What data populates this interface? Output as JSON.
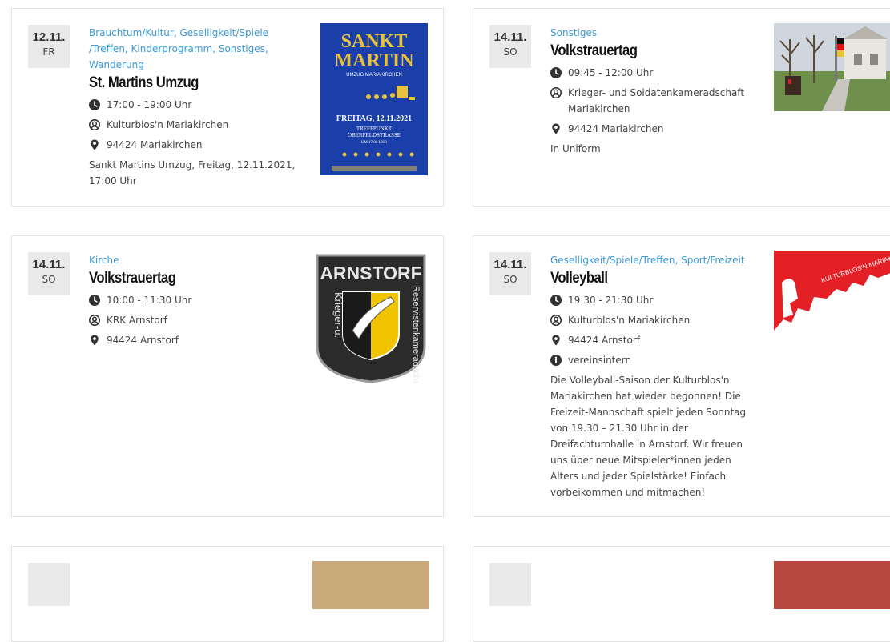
{
  "events": [
    {
      "day": "12.11.",
      "weekday": "FR",
      "categories": "Brauchtum/Kultur, Geselligkeit/Spiele /Treffen, Kinderprogramm, Sonstiges, Wanderung",
      "title": "St. Martins Umzug",
      "time": "17:00 - 19:00 Uhr",
      "organizer": "Kulturblos'n Mariakirchen",
      "location": "94424 Mariakirchen",
      "description": "Sankt Martins Umzug, Freitag, 12.11.2021, 17:00 Uhr",
      "poster": {
        "line1": "SANKT",
        "line2": "MARTIN",
        "line3": "UMZUG MARIAKIRCHEN",
        "line4": "FREITAG, 12.11.2021",
        "line5": "TREFFPUNKT",
        "line6": "OBERFELDSTRASSE",
        "line7": "UM 17:00 UHR"
      }
    },
    {
      "day": "14.11.",
      "weekday": "SO",
      "categories": "Sonstiges",
      "title": "Volkstrauertag",
      "time": "09:45 - 12:00 Uhr",
      "organizer": "Krieger- und Soldatenkameradschaft Mariakirchen",
      "location": "94424 Mariakirchen",
      "description": "In Uniform"
    },
    {
      "day": "14.11.",
      "weekday": "SO",
      "categories": "Kirche",
      "title": "Volkstrauertag",
      "time": "10:00 - 11:30 Uhr",
      "organizer": "KRK Arnstorf",
      "location": "94424 Arnstorf",
      "patch": {
        "top": "ARNSTORF",
        "left": "Krieger-u.",
        "right": "Reservistenkameradschaft"
      }
    },
    {
      "day": "14.11.",
      "weekday": "SO",
      "categories": "Geselligkeit/Spiele/Treffen, Sport/Freizeit",
      "title": "Volleyball",
      "time": "19:30 - 21:30 Uhr",
      "organizer": "Kulturblos'n Mariakirchen",
      "location": "94424 Arnstorf",
      "note": "vereinsintern",
      "description": "Die Volleyball-Saison der Kulturblos'n Mariakirchen hat wieder begonnen! Die Freizeit-Mannschaft spielt jeden Sonntag von 19.30 – 21.30 Uhr in der Dreifachturnhalle in Arnstorf. Wir freuen uns über neue Mitspieler*innen jeden Alters und jeder Spielstärke! Einfach vorbeikommen und mitmachen!",
      "logo_text": "KULTURBLOS'N MARIAKIRCHEN E.V."
    }
  ],
  "colors": {
    "link": "#3b9ad9",
    "date_bg": "#e9e9e9",
    "poster_blue": "#1a3fa8",
    "poster_gold": "#e8c23a",
    "logo_red": "#e41f26"
  }
}
